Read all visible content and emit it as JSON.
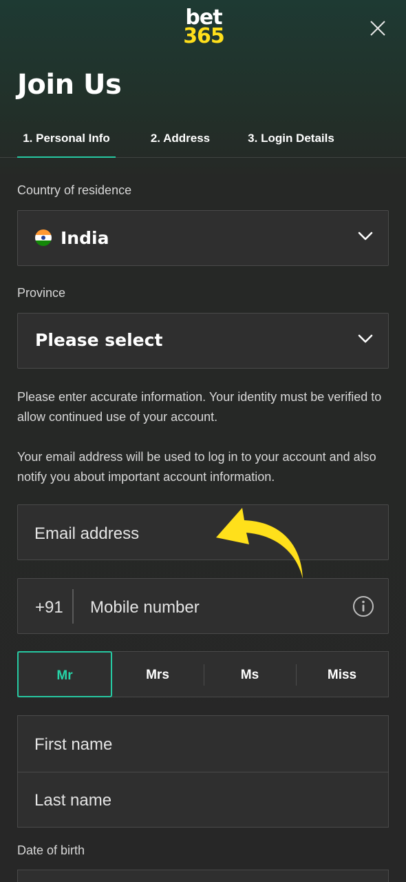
{
  "header": {
    "logo_top": "bet",
    "logo_bottom": "365",
    "logo_colors": {
      "top": "#ffffff",
      "bottom": "#ffdf1b"
    },
    "close_icon": "close-icon"
  },
  "page_title": "Join Us",
  "tabs": [
    {
      "label": "1.  Personal Info",
      "active": true
    },
    {
      "label": "2.  Address",
      "active": false
    },
    {
      "label": "3.  Login Details",
      "active": false
    }
  ],
  "country": {
    "label": "Country of residence",
    "value": "India",
    "flag_icon": "india-flag-icon"
  },
  "province": {
    "label": "Province",
    "value": "Please select"
  },
  "notices": {
    "identity": "Please enter accurate information. Your identity must be verified to allow continued use of your account.",
    "email": "Your email address will be used to log in to your account and also notify you about important account information."
  },
  "email": {
    "placeholder": "Email address"
  },
  "mobile": {
    "prefix": "+91",
    "placeholder": "Mobile number"
  },
  "titles": [
    {
      "label": "Mr",
      "selected": true
    },
    {
      "label": "Mrs",
      "selected": false
    },
    {
      "label": "Ms",
      "selected": false
    },
    {
      "label": "Miss",
      "selected": false
    }
  ],
  "first_name": {
    "placeholder": "First name"
  },
  "last_name": {
    "placeholder": "Last name"
  },
  "dob": {
    "label": "Date of birth"
  },
  "colors": {
    "accent": "#26c9a2",
    "annotation_arrow": "#ffe01b"
  }
}
